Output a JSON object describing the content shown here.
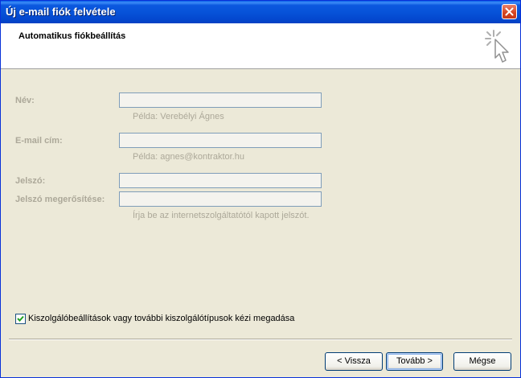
{
  "window": {
    "title": "Új e-mail fiók felvétele"
  },
  "header": {
    "title": "Automatikus fiókbeállítás"
  },
  "form": {
    "name": {
      "label": "Név:",
      "value": "",
      "hint": "Példa: Verebélyi Ágnes"
    },
    "email": {
      "label": "E-mail cím:",
      "value": "",
      "hint": "Példa: agnes@kontraktor.hu"
    },
    "password": {
      "label": "Jelszó:",
      "value": ""
    },
    "password_confirm": {
      "label": "Jelszó megerősítése:",
      "value": "",
      "hint": "Írja be az internetszolgáltatótól kapott jelszót."
    }
  },
  "manual_config": {
    "label": "Kiszolgálóbeállítások vagy további kiszolgálótípusok kézi megadása",
    "checked": true
  },
  "buttons": {
    "back": "< Vissza",
    "next": "Tovább >",
    "cancel": "Mégse"
  },
  "colors": {
    "titlebar": "#0753d9",
    "disabled_text": "#aca899",
    "face": "#ece9d8"
  }
}
